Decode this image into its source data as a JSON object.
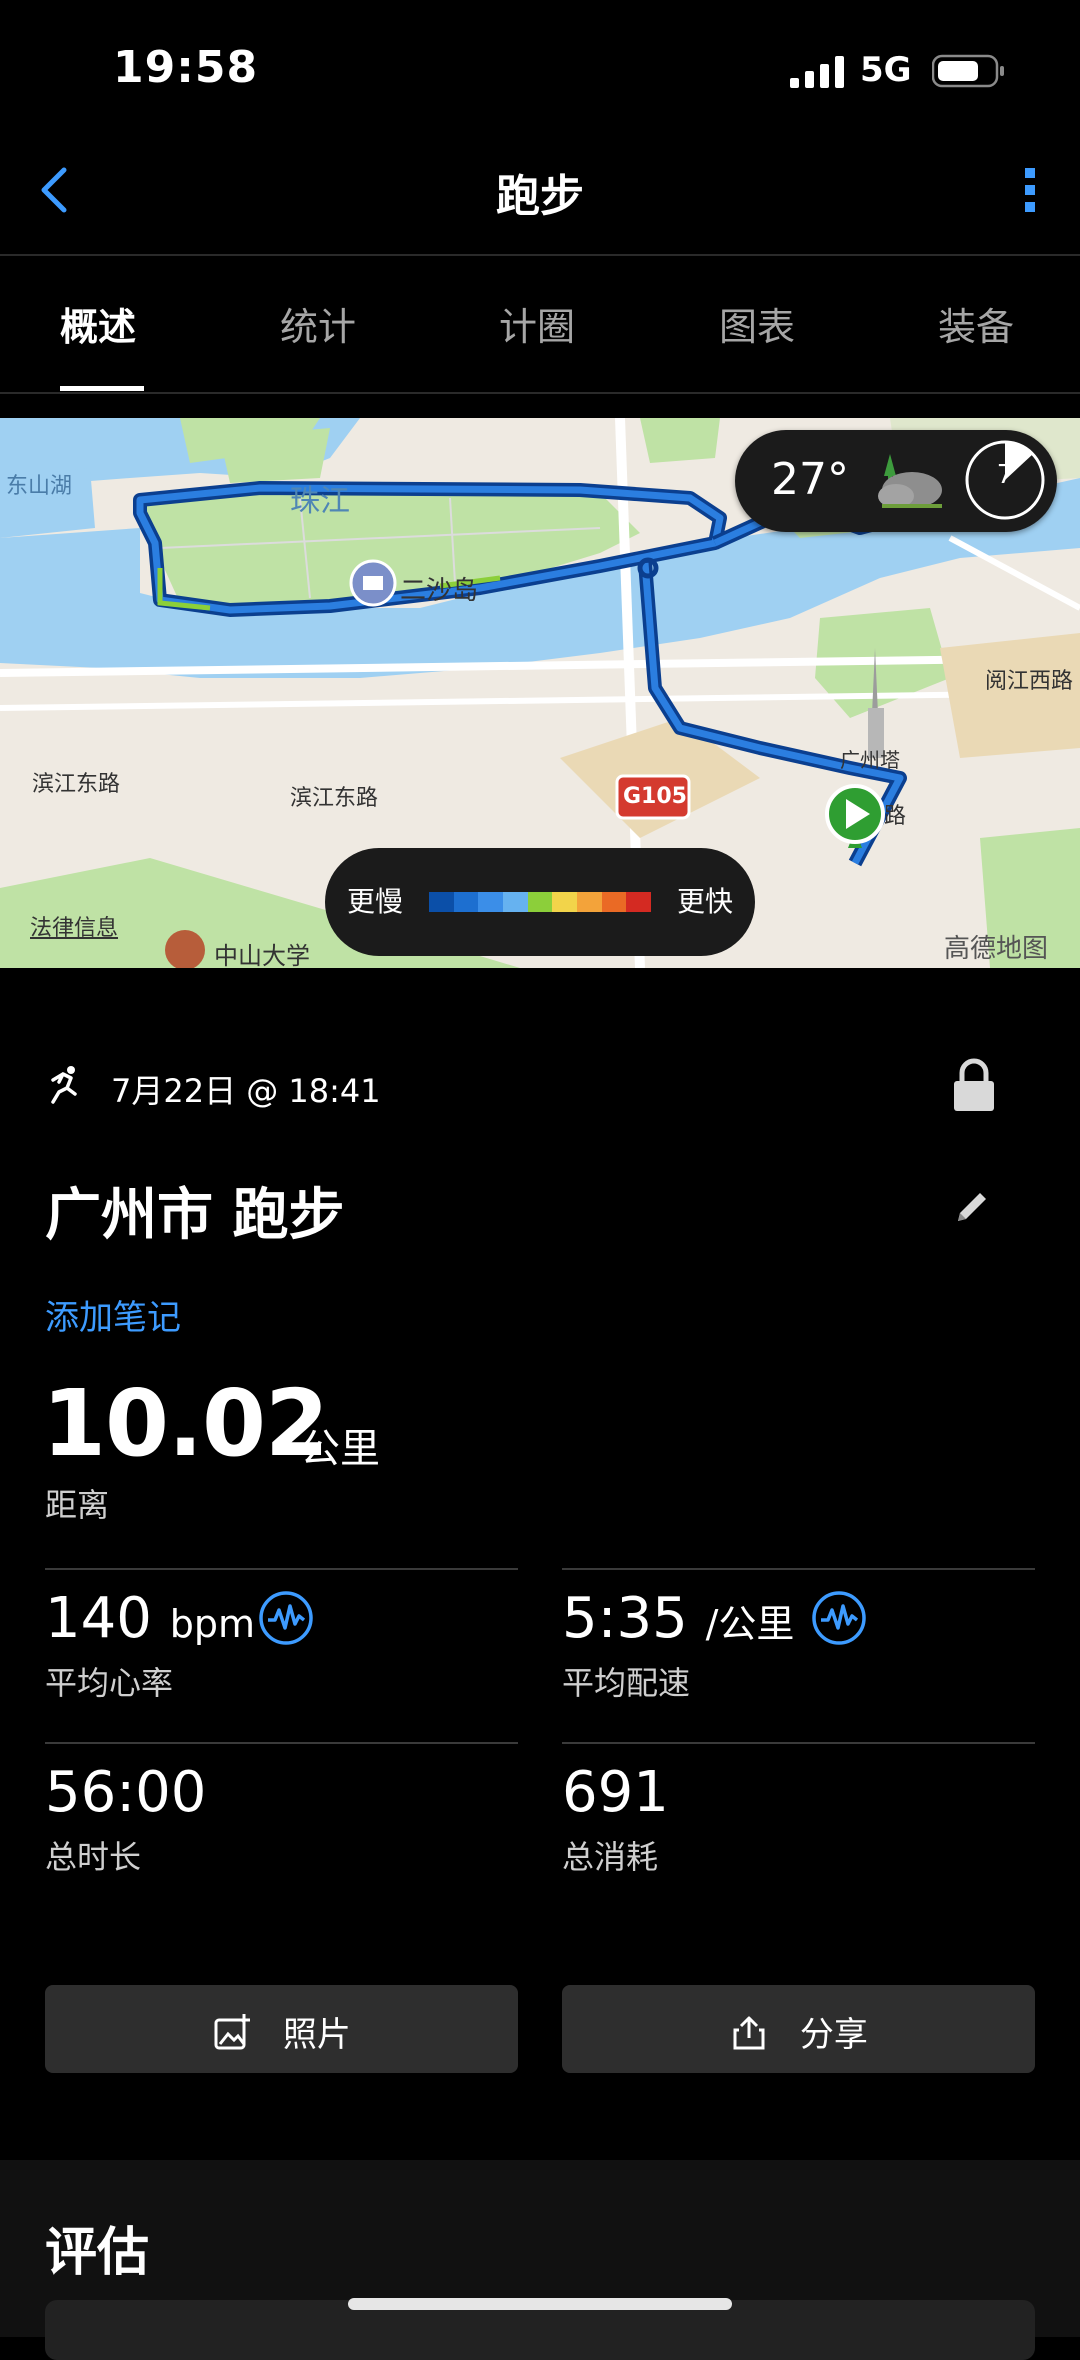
{
  "status_bar": {
    "time": "19:58",
    "network": "5G"
  },
  "nav": {
    "title": "跑步"
  },
  "tabs": [
    {
      "label": "概述",
      "active": true
    },
    {
      "label": "统计",
      "active": false
    },
    {
      "label": "计圈",
      "active": false
    },
    {
      "label": "图表",
      "active": false
    },
    {
      "label": "装备",
      "active": false
    }
  ],
  "map": {
    "labels": {
      "lake": "东山湖",
      "river": "珠江",
      "island": "二沙岛",
      "road_left": "滨江东路",
      "road_mid": "滨江东路",
      "road_right": "阅江西路",
      "tower": "广州塔",
      "road_char": "路",
      "highway": "G105",
      "poi_bottom_left": "法律信息",
      "poi_bottom": "中山大学",
      "attribution": "高德地图"
    },
    "weather": {
      "temperature": "27°",
      "time_marker": "7"
    },
    "legend": {
      "slow": "更慢",
      "fast": "更快",
      "colors": [
        "#0b4fa8",
        "#1d6fd0",
        "#3b8ee8",
        "#66b2f0",
        "#8ccf3a",
        "#f2d44a",
        "#f3a33a",
        "#ea6a25",
        "#d42a22"
      ]
    }
  },
  "activity": {
    "date": "7月22日 @ 18:41",
    "title": "广州市 跑步",
    "add_note": "添加笔记",
    "distance": {
      "value": "10.02",
      "unit": "公里",
      "label": "距离"
    },
    "stats": [
      {
        "value": "140",
        "unit": "bpm",
        "label": "平均心率"
      },
      {
        "value": "5:35",
        "unit": "/公里",
        "label": "平均配速"
      },
      {
        "value": "56:00",
        "unit": "",
        "label": "总时长"
      },
      {
        "value": "691",
        "unit": "",
        "label": "总消耗"
      }
    ]
  },
  "buttons": {
    "photo": "照片",
    "share": "分享"
  },
  "evaluation": {
    "title": "评估"
  },
  "colors": {
    "accent": "#3d9bff",
    "background": "#000000"
  }
}
